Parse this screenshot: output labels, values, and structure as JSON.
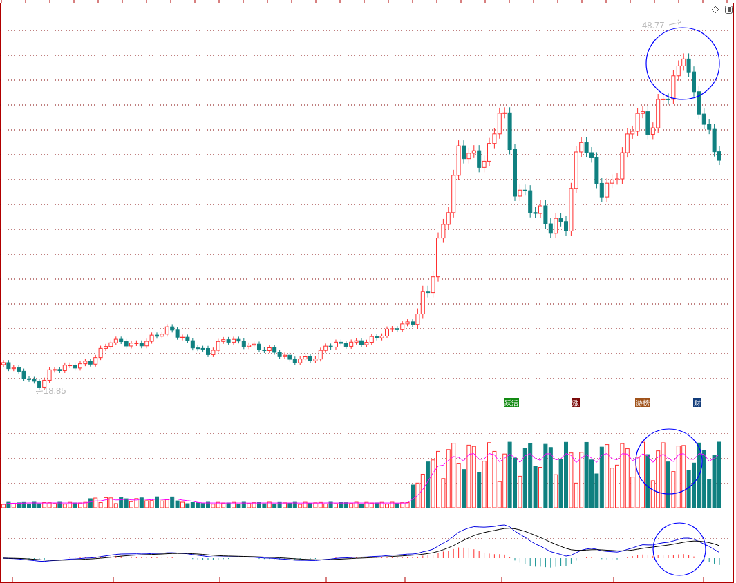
{
  "chart": {
    "high_label": "48.77",
    "low_label": "18.85",
    "event_tags": [
      {
        "label": "跃活",
        "color": "#128a12"
      },
      {
        "label": "涨",
        "color": "#7a0a0a"
      },
      {
        "label": "游榜",
        "color": "#a0521a"
      },
      {
        "label": "财",
        "color": "#123c7a"
      }
    ]
  }
}
